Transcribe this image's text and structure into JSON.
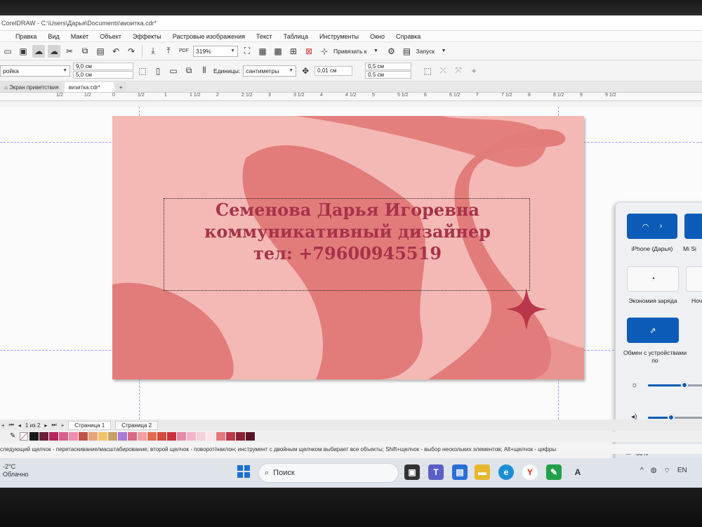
{
  "app": {
    "title": "CorelDRAW - C:\\Users\\Дарья\\Documents\\визитка.cdr*"
  },
  "menu": [
    "Правка",
    "Вид",
    "Макет",
    "Объект",
    "Эффекты",
    "Растровые изображения",
    "Текст",
    "Таблица",
    "Инструменты",
    "Окно",
    "Справка"
  ],
  "toolbar": {
    "zoom": "319%",
    "snap_label": "Привязать к",
    "launch_label": "Запуск",
    "pdf_label": "PDF"
  },
  "propbar": {
    "preset": "ройка",
    "width": "9,0 см",
    "height": "5,0 см",
    "units_label": "Единицы:",
    "units_value": "сантиметры",
    "nudge": "0,01 см",
    "dup_x": "0,5 см",
    "dup_y": "0,5 см"
  },
  "tabs": {
    "welcome": "Экран приветствия",
    "document": "визитка.cdr*"
  },
  "ruler_labels": [
    "1/2",
    "1/2",
    "0",
    "1/2",
    "1",
    "1 1/2",
    "2",
    "2 1/2",
    "3",
    "3 1/2",
    "4",
    "4 1/2",
    "5",
    "5 1/2",
    "6",
    "6 1/2",
    "7",
    "7 1/2",
    "8",
    "8 1/2",
    "9",
    "9 1/2"
  ],
  "card": {
    "line1": "Семенова Дарья Игоревна",
    "line2": "коммуникативный дизайнер",
    "line3": "тел: +79600945519",
    "background_color": "#f4b9b4",
    "wave_color": "#e07a7a",
    "text_color": "#a8324a"
  },
  "pages": {
    "counter": "1 из 2",
    "page1": "Страница 1",
    "page2": "Страница 2"
  },
  "palette_colors": [
    "#1a1a1a",
    "#6b1d3a",
    "#b3285e",
    "#d9608d",
    "#f08eb0",
    "#c1524a",
    "#e8a37a",
    "#f2c46a",
    "#c79f67",
    "#a77ad4",
    "#d86a83",
    "#f1a1a1",
    "#e06b52",
    "#d44a3a",
    "#c7333a",
    "#e58aa6",
    "#f3b6c8",
    "#f5d2da",
    "#fbe6ea",
    "#e2777c",
    "#b93a48",
    "#8b2233",
    "#5c1527"
  ],
  "status": {
    "hint": "следующий щелчок - перетаскивание/масштабирование; второй щелчок - поворот/наклон; инструмент с двойным щелчком выбирает все объекты; Shift+щелчок - выбор нескольких элементов; Alt+щелчок - цифры"
  },
  "taskbar": {
    "temp": "-2°C",
    "weather": "Облачно",
    "search_placeholder": "Поиск",
    "lang": "EN"
  },
  "quick_settings": {
    "wifi_label": "iPhone (Дарья)",
    "bt_label": "Mi Si",
    "battery_saver_label": "Экономия заряда",
    "night_label": "Ноч",
    "nearby_label": "Обмен с устройствами по",
    "battery": "30%",
    "brightness_level": 0.55,
    "volume_level": 0.35
  }
}
